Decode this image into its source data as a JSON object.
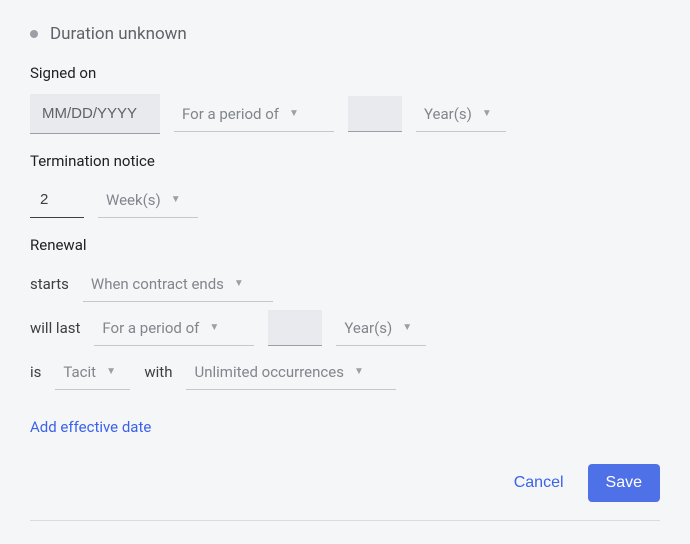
{
  "header": {
    "title": "Duration unknown"
  },
  "signed_on": {
    "label": "Signed on",
    "date_placeholder": "MM/DD/YYYY",
    "date_value": "",
    "period_type": "For a period of",
    "period_value": "",
    "period_unit": "Year(s)"
  },
  "termination": {
    "label": "Termination notice",
    "value": "2",
    "unit": "Week(s)"
  },
  "renewal": {
    "label": "Renewal",
    "starts_label": "starts",
    "starts_value": "When contract ends",
    "will_last_label": "will last",
    "will_last_type": "For a period of",
    "will_last_value": "",
    "will_last_unit": "Year(s)",
    "is_label": "is",
    "is_value": "Tacit",
    "with_label": "with",
    "with_value": "Unlimited occurrences"
  },
  "effective_date": {
    "link_label": "Add effective date"
  },
  "footer": {
    "cancel_label": "Cancel",
    "save_label": "Save"
  }
}
